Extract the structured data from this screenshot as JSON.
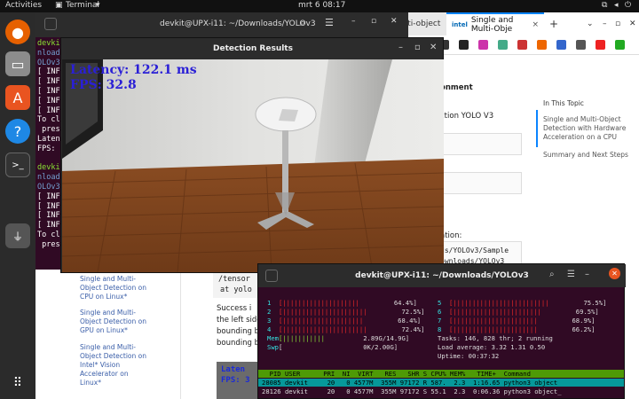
{
  "topbar": {
    "activities": "Activities",
    "app": "Terminal",
    "clock": "mrt 6  08:17"
  },
  "browser": {
    "tab_partial": "ulti-object",
    "tab_active": "Single and Multi-Obje",
    "tab_close": "×",
    "tab_new": "+",
    "heading_partial": "onment",
    "step_partial": "ction YOLO V3",
    "run_partial": "ation:",
    "code_line1": "ds/YOLOv3/Sample",
    "code_line2": "ownloads/YOLOv3",
    "in_this_topic": "In This Topic",
    "topic_link1": "Single and Multi-Object Detection with Hardware Acceleration on a CPU",
    "topic_link2": "Summary and Next Steps"
  },
  "docpage": {
    "sidebar_link1": "Single and Multi-Object Detection on CPU on Linux*",
    "sidebar_link2": "Single and Multi-Object Detection on GPU on Linux*",
    "sidebar_link3": "Single and Multi-Object Detection on Intel* Vision Accelerator on Linux*",
    "code_partial1": "/tensor",
    "code_partial2": "at yolo",
    "success_line1": "Success i",
    "success_line2": "the left side",
    "success_line3": "bounding b",
    "success_line4": "bounding b",
    "thumb_latency": "Laten",
    "thumb_fps": "FPS: 3"
  },
  "term1": {
    "title": "devkit@UPX-i11: ~/Downloads/YOLOv3",
    "lines": [
      "devkit",
      "nloads",
      "OLOv3",
      "[ INFO",
      "[ INFO",
      "[ INFO",
      "[ INFO",
      "[ INFO",
      "To clo",
      " press",
      "Latenc",
      "FPS: ",
      "",
      "devkit",
      "nloads",
      "OLOv3",
      "[ INFO",
      "[ INFO",
      "[ INFO",
      "[ INFO",
      "To clo",
      " press"
    ]
  },
  "detection": {
    "title": "Detection Results",
    "latency": "Latency: 122.1 ms",
    "fps": "FPS: 32.8"
  },
  "htop": {
    "title": "devkit@UPX-i11: ~/Downloads/YOLOv3",
    "cpus_left": [
      {
        "id": "1",
        "bar": "[||||||||||||||||||||",
        "pct": "64.4%]"
      },
      {
        "id": "2",
        "bar": "[||||||||||||||||||||||",
        "pct": "72.5%]"
      },
      {
        "id": "3",
        "bar": "[|||||||||||||||||||||",
        "pct": "68.4%]"
      },
      {
        "id": "4",
        "bar": "[||||||||||||||||||||||",
        "pct": "72.4%]"
      }
    ],
    "cpus_right": [
      {
        "id": "5",
        "bar": "[|||||||||||||||||||||||||",
        "pct": "75.5%]"
      },
      {
        "id": "6",
        "bar": "[|||||||||||||||||||||||",
        "pct": "69.5%]"
      },
      {
        "id": "7",
        "bar": "[||||||||||||||||||||||",
        "pct": "68.9%]"
      },
      {
        "id": "8",
        "bar": "[||||||||||||||||||||||",
        "pct": "66.2%]"
      }
    ],
    "mem_label": "Mem",
    "mem_bar": "[|||||||||||",
    "mem_value": "2.89G/14.9G]",
    "swp_label": "Swp",
    "swp_bar": "[",
    "swp_value": "0K/2.00G]",
    "tasks": "Tasks: 146, 828 thr; 2 running",
    "load": "Load average: 3.32 1.31 0.50",
    "uptime": "Uptime: 00:37:32",
    "header": "  PID USER      PRI  NI  VIRT   RES   SHR S CPU% MEM%   TIME+  Command",
    "rows": [
      "28085 devkit     20   0 4577M  355M 97172 R 587.  2.3  1:16.65 python3 object",
      "28126 devkit     20   0 4577M  355M 97172 S 55.1  2.3  0:06.36 python3 object_"
    ]
  }
}
